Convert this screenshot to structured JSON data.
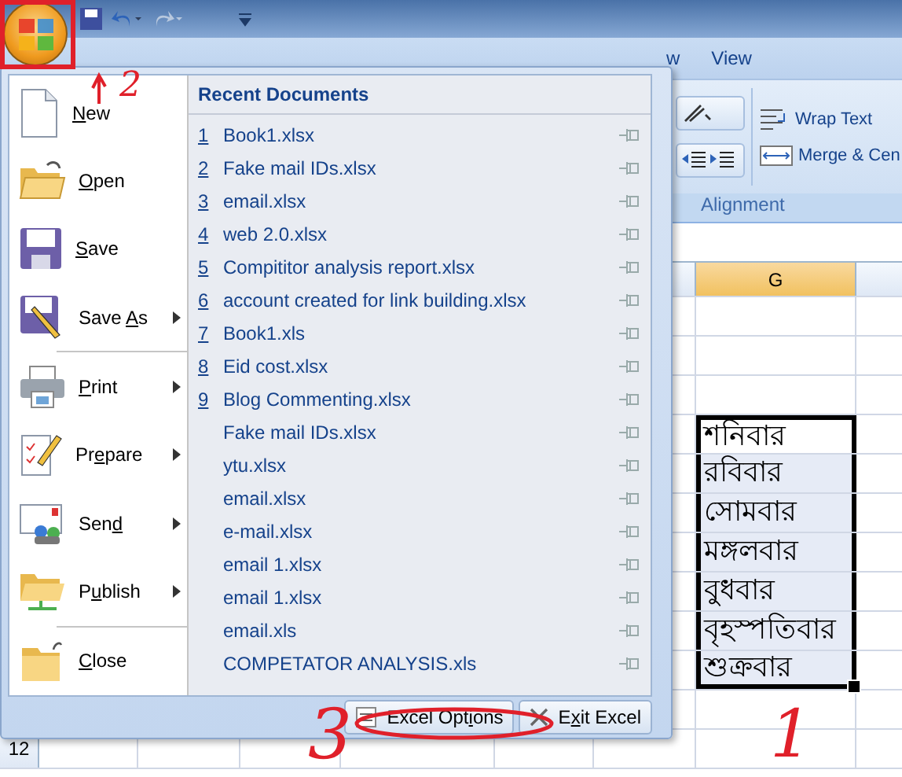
{
  "quick_access": [
    {
      "kind": "save",
      "enabled": true
    },
    {
      "kind": "undo",
      "enabled": true
    },
    {
      "kind": "redo",
      "enabled": false
    }
  ],
  "ribbon": {
    "tabs": [
      {
        "label": "w"
      },
      {
        "label": "View"
      }
    ],
    "commands": [
      {
        "kind": "wrap",
        "label": "Wrap Text"
      },
      {
        "kind": "merge",
        "label": "Merge & Cen"
      }
    ],
    "group_label": "Alignment"
  },
  "sheet": {
    "columns": [
      {
        "label": "G",
        "selected": true
      }
    ],
    "visible_row_number": "12",
    "cells": [
      {
        "text": "শনিবার",
        "active": true
      },
      {
        "text": "রবিবার",
        "active": false
      },
      {
        "text": "সোমবার",
        "active": false
      },
      {
        "text": "মঙ্গলবার",
        "active": false
      },
      {
        "text": "বুধবার",
        "active": false
      },
      {
        "text": "বৃহস্পতিবার",
        "active": false
      },
      {
        "text": "শুক্রবার",
        "active": false
      }
    ]
  },
  "office_menu": {
    "commands": [
      {
        "key": "N",
        "post": "ew",
        "submenu": false,
        "separator_before": false
      },
      {
        "key": "O",
        "post": "pen",
        "submenu": false,
        "separator_before": false
      },
      {
        "key": "S",
        "post": "ave",
        "submenu": false,
        "separator_before": false
      },
      {
        "pre": "Save ",
        "key": "A",
        "post": "s",
        "submenu": true,
        "separator_before": false
      },
      {
        "key": "P",
        "post": "rint",
        "submenu": true,
        "separator_before": true
      },
      {
        "pre": "Pr",
        "key": "e",
        "post": "pare",
        "submenu": true,
        "separator_before": false
      },
      {
        "pre": "Sen",
        "key": "d",
        "submenu": true,
        "separator_before": false
      },
      {
        "pre": "P",
        "key": "u",
        "post": "blish",
        "submenu": true,
        "separator_before": false
      },
      {
        "key": "C",
        "post": "lose",
        "submenu": false,
        "separator_before": true
      }
    ],
    "recent_title": "Recent Documents",
    "recent": [
      {
        "number": "1",
        "name": "Book1.xlsx"
      },
      {
        "number": "2",
        "name": "Fake mail IDs.xlsx"
      },
      {
        "number": "3",
        "name": "email.xlsx"
      },
      {
        "number": "4",
        "name": "web 2.0.xlsx"
      },
      {
        "number": "5",
        "name": "Compititor analysis report.xlsx"
      },
      {
        "number": "6",
        "name": "account created for link building.xlsx"
      },
      {
        "number": "7",
        "name": "Book1.xls"
      },
      {
        "number": "8",
        "name": "Eid cost.xlsx"
      },
      {
        "number": "9",
        "name": "Blog Commenting.xlsx"
      },
      {
        "name": "Fake mail IDs.xlsx"
      },
      {
        "name": "ytu.xlsx"
      },
      {
        "name": "email.xlsx"
      },
      {
        "name": "e-mail.xlsx"
      },
      {
        "name": "email 1.xlsx"
      },
      {
        "name": "email 1.xlsx"
      },
      {
        "name": "email.xls"
      },
      {
        "name": "COMPETATOR ANALYSIS.xls"
      }
    ],
    "buttons": [
      {
        "kind": "options",
        "pre": "Excel Opt",
        "key": "i",
        "post": "ons"
      },
      {
        "kind": "exit",
        "pre": "E",
        "key": "x",
        "post": "it Excel"
      }
    ]
  },
  "annotations": [
    {
      "text": "2"
    },
    {
      "text": "3"
    },
    {
      "text": "1"
    }
  ]
}
